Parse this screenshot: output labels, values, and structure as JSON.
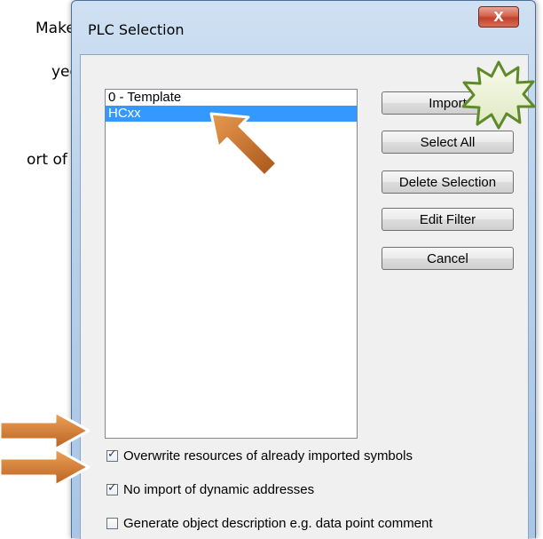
{
  "background": {
    "lines": [
      "Make",
      "yed",
      "ort of"
    ]
  },
  "dialog": {
    "title": "PLC Selection",
    "close_glyph": "X",
    "list_items": [
      {
        "label": "0 - Template",
        "selected": false
      },
      {
        "label": "HCxx",
        "selected": true
      }
    ],
    "buttons": {
      "import": "Import",
      "select_all": "Select All",
      "delete_selection": "Delete Selection",
      "edit_filter": "Edit Filter",
      "cancel": "Cancel"
    },
    "checkboxes": [
      {
        "label": "Overwrite resources of already imported symbols",
        "checked": true
      },
      {
        "label": "No import of dynamic addresses",
        "checked": true
      },
      {
        "label": "Generate object description e.g. data point comment",
        "checked": false
      }
    ]
  },
  "annotations": {
    "arrow_color": "#c96a1e",
    "starburst_color": "#5f8a2a",
    "icons": [
      "arrow-up-left-icon",
      "arrow-right-icon",
      "arrow-right-icon",
      "starburst-icon"
    ]
  }
}
